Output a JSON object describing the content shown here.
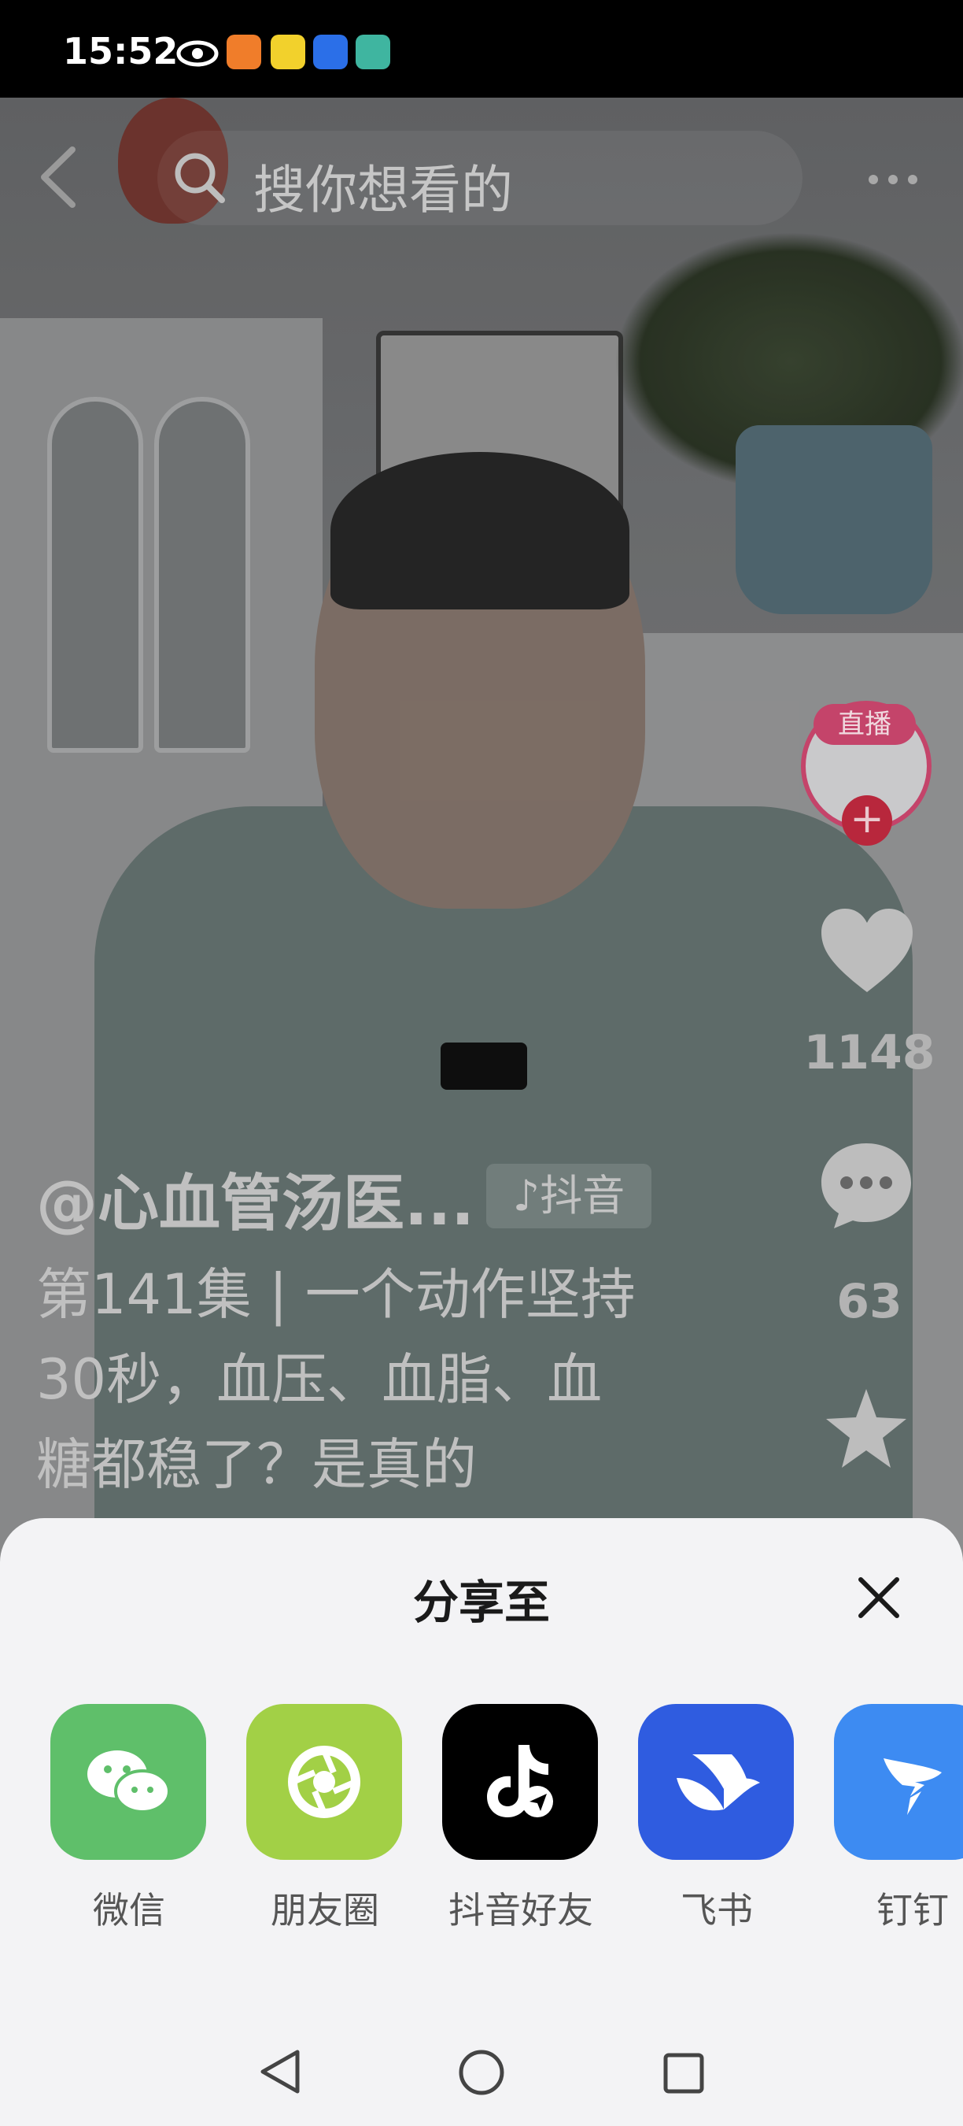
{
  "status_bar": {
    "time": "15:52"
  },
  "search": {
    "placeholder": "搜你想看的"
  },
  "rail": {
    "live_label": "直播",
    "follow_symbol": "+",
    "like_count": "1148",
    "comment_count": "63"
  },
  "video": {
    "author": "@心血管汤医...",
    "tag": "♪抖音",
    "caption": "第141集 | 一个动作坚持30秒，血压、血脂、血糖都稳了？是真的"
  },
  "share": {
    "title": "分享至",
    "targets": [
      {
        "label": "微信",
        "icon": "wechat-icon",
        "color": "#5fbf6a"
      },
      {
        "label": "朋友圈",
        "icon": "moments-icon",
        "color": "#a2d046"
      },
      {
        "label": "抖音好友",
        "icon": "douyin-icon",
        "color": "#000000"
      },
      {
        "label": "飞书",
        "icon": "feishu-icon",
        "color": "#2f5ce0"
      },
      {
        "label": "钉钉",
        "icon": "dingtalk-icon",
        "color": "#3d8bf2"
      }
    ]
  }
}
